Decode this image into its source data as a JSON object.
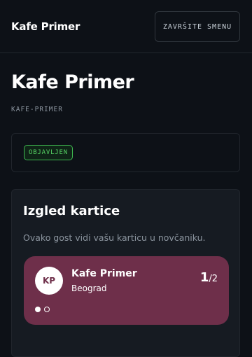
{
  "header": {
    "app_name": "Kafe Primer",
    "end_shift_label": "ZAVRŠITE SMENU"
  },
  "page": {
    "title": "Kafe Primer",
    "slug": "KAFE-PRIMER",
    "status_badge": "OBJAVLJEN"
  },
  "preview": {
    "title": "Izgled kartice",
    "description": "Ovako gost vidi vašu karticu u novčaniku.",
    "card": {
      "initials": "KP",
      "business_name": "Kafe Primer",
      "city": "Beograd",
      "stamps_current": "1",
      "stamps_total": "/2",
      "stamps_progress": 0.5,
      "card_color": "#6e2f4a",
      "dots": [
        "filled",
        "empty"
      ]
    }
  },
  "colors": {
    "background": "#0d1117",
    "badge_green": "#56d364",
    "card": "#6e2f4a"
  }
}
